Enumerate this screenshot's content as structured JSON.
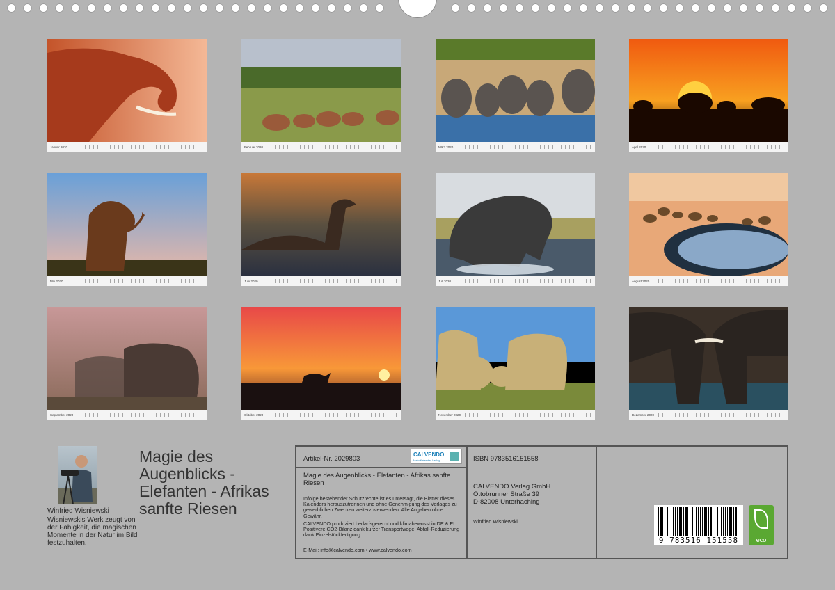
{
  "months": [
    {
      "label": "Januar 2020"
    },
    {
      "label": "Februar 2020"
    },
    {
      "label": "März 2020"
    },
    {
      "label": "April 2020"
    },
    {
      "label": "Mai 2020"
    },
    {
      "label": "Juni 2020"
    },
    {
      "label": "Juli 2020"
    },
    {
      "label": "August 2020"
    },
    {
      "label": "September 2020"
    },
    {
      "label": "Oktober 2020"
    },
    {
      "label": "November 2020"
    },
    {
      "label": "Dezember 2020"
    }
  ],
  "author": {
    "name": "Winfried Wisniewski",
    "bio": "Wisniewskis Werk zeugt von der Fähigkeit, die magischen Momente in der Natur im Bild festzuhalten."
  },
  "title": "Magie des Augenblicks - Elefanten - Afrikas sanfte Riesen",
  "panel": {
    "artikel": "Artikel-Nr. 2029803",
    "logo": "CALVENDO",
    "logo_sub": "Mein Kalender-Verlag",
    "subtitle": "Magie des Augenblicks - Elefanten - Afrikas sanfte Riesen",
    "legal1": "Infolge bestehender Schutzrechte ist es untersagt, die Blätter dieses Kalenders herauszutrennen und ohne Genehmigung des Verlages zu gewerblichen Zwecken weiterzuverwenden. Alle Angaben ohne Gewähr.",
    "legal2": "CALVENDO produziert bedarfsgerecht und klimabewusst in DE & EU. Positivere CO2-Bilanz dank kurzer Transportwege. Abfall-Reduzierung dank Einzelstückfertigung.",
    "contact": "E-Mail: info@calvendo.com • www.calvendo.com",
    "isbn": "ISBN 9783516151558",
    "publisher1": "CALVENDO Verlag GmbH",
    "publisher2": "Ottobrunner Straße 39",
    "publisher3": "D-82008 Unterhaching",
    "photographer": "Winfried Wisniewski",
    "barcode": "9 783516 151558",
    "eco": "eco"
  }
}
